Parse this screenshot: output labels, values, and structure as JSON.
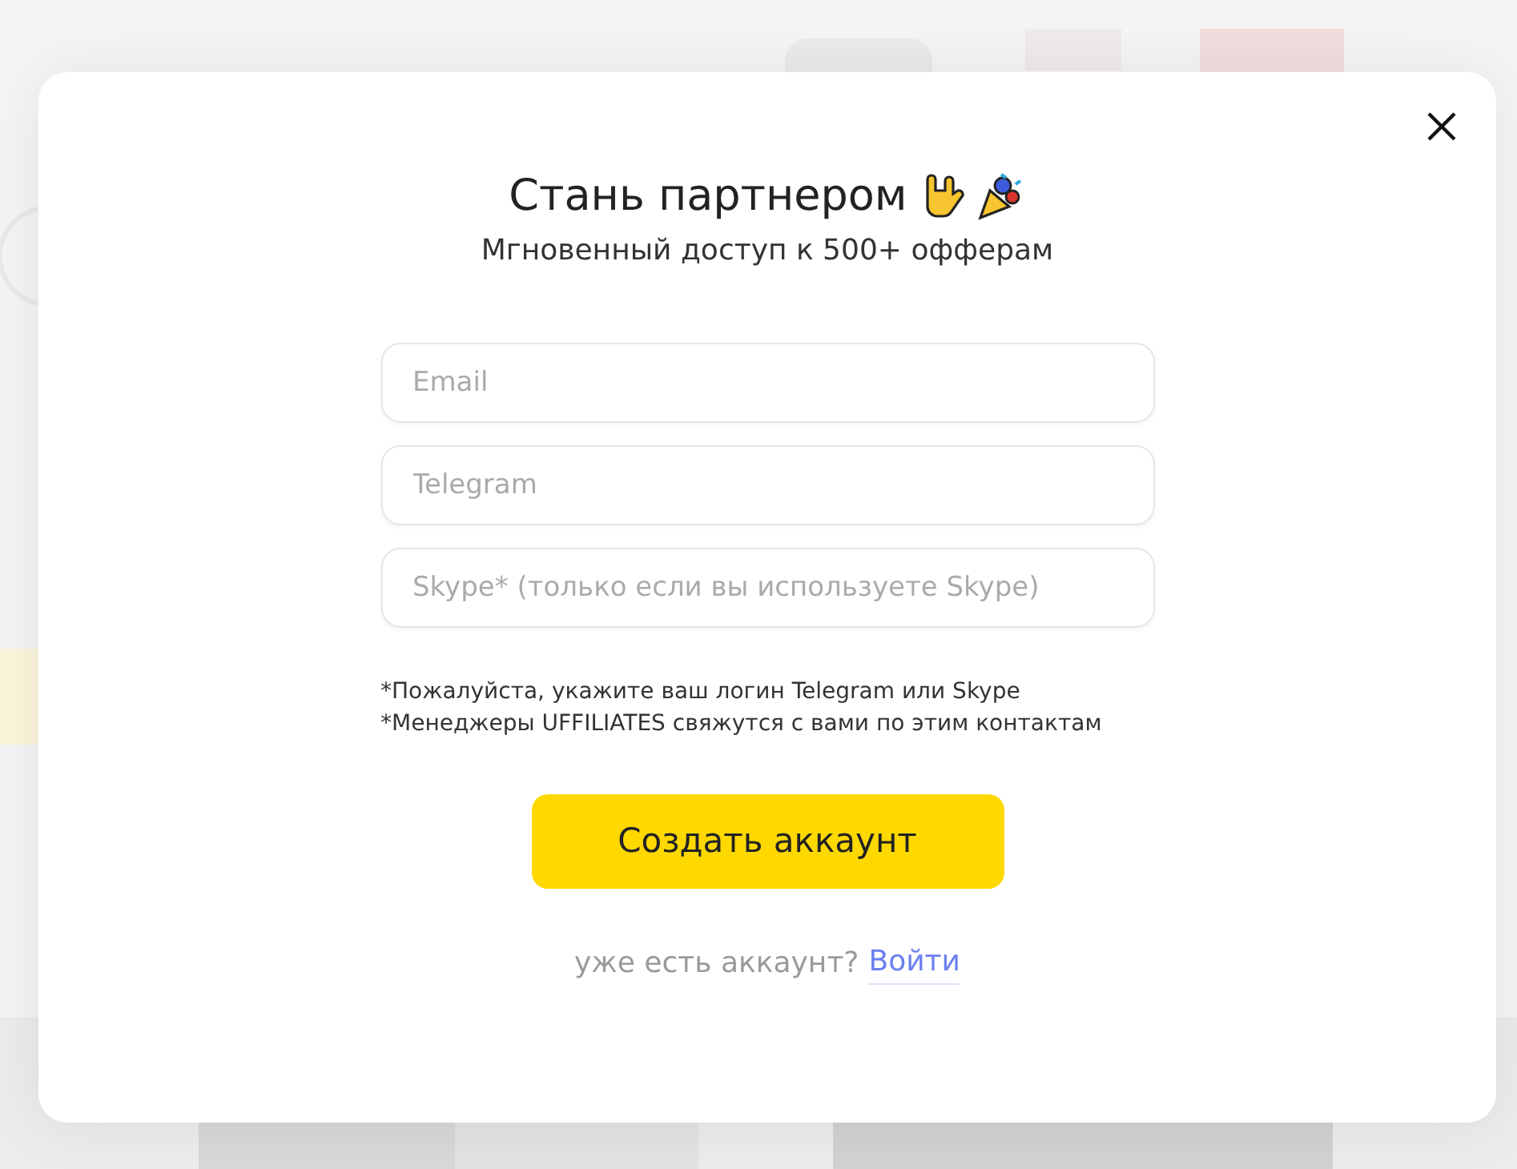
{
  "modal": {
    "title": "Стань партнером",
    "subtitle": "Мгновенный доступ к 500+ офферам",
    "fields": [
      {
        "placeholder": "Email"
      },
      {
        "placeholder": "Telegram"
      },
      {
        "placeholder": "Skype* (только если вы используете Skype)"
      }
    ],
    "notes": [
      "*Пожалуйста, укажите ваш логин Telegram или Skype",
      "*Менеджеры UFFILIATES свяжутся с вами по этим контактам"
    ],
    "submit": "Создать аккаунт",
    "login_prompt": "уже есть аккаунт?",
    "login_link": "Войти"
  }
}
